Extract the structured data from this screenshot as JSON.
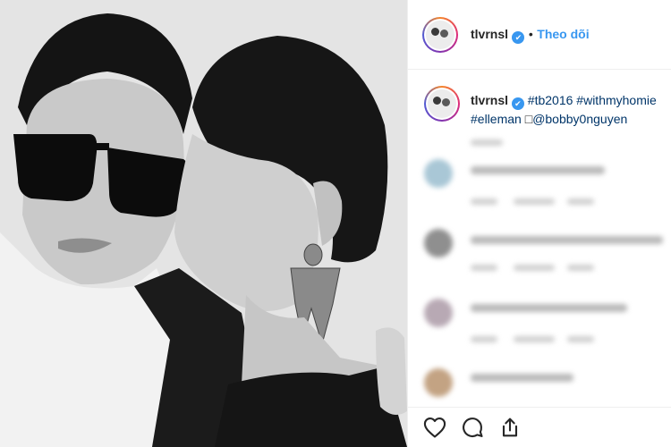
{
  "post": {
    "author": {
      "username": "tlvrnsl",
      "verified_glyph": "✔"
    },
    "header": {
      "separator": "•",
      "follow_label": "Theo dõi"
    },
    "caption": {
      "username": "tlvrnsl",
      "tag1": "#tb2016",
      "tag2": "#withmyhomie",
      "tag3": "#elleman",
      "glyph": "□",
      "mention": "@bobby0nguyen"
    }
  },
  "actions": {
    "like_icon": "heart-icon",
    "comment_icon": "comment-icon",
    "share_icon": "share-icon"
  },
  "colors": {
    "accent": "#3897f0",
    "text": "#262626",
    "hashtag": "#003569",
    "border": "#efefef"
  }
}
